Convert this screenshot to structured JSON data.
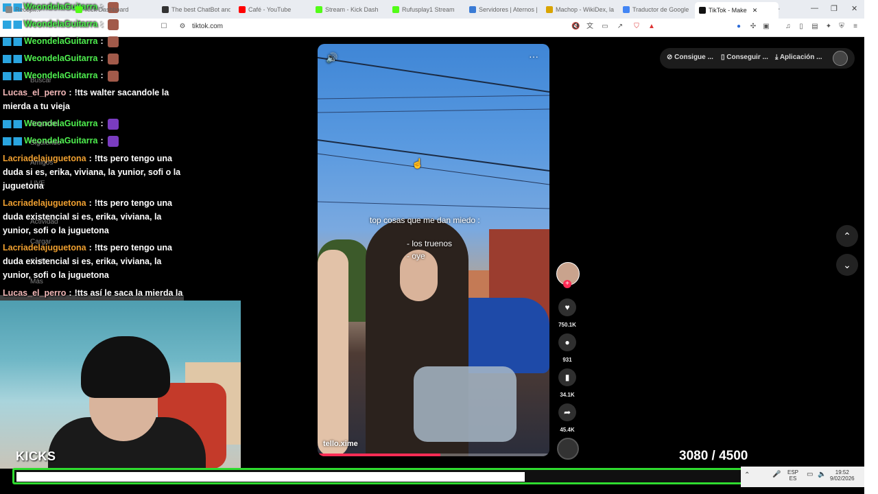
{
  "browser": {
    "tabs": [
      {
        "label": "Recopi…",
        "color": "#888888"
      },
      {
        "label": "Kick Dashboard",
        "color": "#53fc18"
      },
      {
        "label": "The best ChatBot and",
        "color": "#333333"
      },
      {
        "label": "Café - YouTube",
        "color": "#ff0000"
      },
      {
        "label": "Stream - Kick Dash",
        "color": "#53fc18"
      },
      {
        "label": "Rufusplay1 Stream",
        "color": "#53fc18"
      },
      {
        "label": "Servidores | Aternos | E",
        "color": "#3a7bd5"
      },
      {
        "label": "Machop - WikiDex, la",
        "color": "#d9a400"
      },
      {
        "label": "Traductor de Google",
        "color": "#4285f4"
      },
      {
        "label": "TikTok - Make",
        "color": "#111111"
      }
    ],
    "url": "tiktok.com",
    "new_tab": "+",
    "window": {
      "minimize": "—",
      "restore": "❐",
      "close": "✕"
    }
  },
  "tiktok": {
    "top_pill": {
      "item1": "Consigue ...",
      "item2": "Conseguir ...",
      "item3": "Aplicación ..."
    },
    "sidebar_ghost": [
      "Buscar",
      "Seguidos",
      "Siguiendo",
      "Amigos",
      "LIVE",
      "Actividad",
      "Cargar",
      "Perfil",
      "Más"
    ],
    "video": {
      "caption_title": "top cosas que me dan miedo :",
      "caption_line1": "- los truenos",
      "caption_line2": "- oye",
      "author": "tello.xime",
      "more": "···",
      "progress": 0.53
    },
    "actions": {
      "likes": "750.1K",
      "comments": "931",
      "saves": "34.1K",
      "shares": "45.4K"
    }
  },
  "chat": [
    {
      "user": "WeondelaGuitarra",
      "sep": ":",
      "msg": "",
      "emote": "#a25a4a",
      "color": "green",
      "badges": true
    },
    {
      "user": "WeondelaGuitarra",
      "sep": ":",
      "msg": "",
      "emote": "#a25a4a",
      "color": "green",
      "badges": true
    },
    {
      "user": "WeondelaGuitarra",
      "sep": ":",
      "msg": "",
      "emote": "#a25a4a",
      "color": "green",
      "badges": true
    },
    {
      "user": "WeondelaGuitarra",
      "sep": ":",
      "msg": "",
      "emote": "#a25a4a",
      "color": "green",
      "badges": true
    },
    {
      "user": "WeondelaGuitarra",
      "sep": ":",
      "msg": "",
      "emote": "#a25a4a",
      "color": "green",
      "badges": true
    },
    {
      "user": "Lucas_el_perro",
      "sep": ":",
      "msg": "!tts walter sacandole la mierda a tu vieja",
      "color": "pink",
      "badges": false
    },
    {
      "user": "WeondelaGuitarra",
      "sep": ":",
      "msg": "",
      "emote": "#7a3cc0",
      "color": "green",
      "badges": true
    },
    {
      "user": "WeondelaGuitarra",
      "sep": ":",
      "msg": "",
      "emote": "#7a3cc0",
      "color": "green",
      "badges": true
    },
    {
      "user": "Lacriadelajuguetona",
      "sep": ":",
      "msg": "!tts pero tengo una duda si es, erika, viviana, la yunior, sofi o la juguetona",
      "color": "orange",
      "badges": false
    },
    {
      "user": "Lacriadelajuguetona",
      "sep": ":",
      "msg": "!tts pero tengo una duda existencial si es, erika, viviana, la yunior, sofi o la juguetona",
      "color": "orange",
      "badges": false
    },
    {
      "user": "Lacriadelajuguetona",
      "sep": ":",
      "msg": "!tts pero tengo una duda existencial si es, erika, viviana, la yunior, sofi o la juguetona",
      "color": "orange",
      "badges": false
    },
    {
      "user": "Lucas_el_perro",
      "sep": ":",
      "msg": "!tts así le saca la mierda la payasa al enano",
      "color": "pink",
      "badges": false
    }
  ],
  "overlay": {
    "kicks_label": "KICKS",
    "counter": "3080  / 4500",
    "goal_progress": 0.68
  },
  "taskbar": {
    "lang": "ESP",
    "lang2": "ES",
    "time": "19:52",
    "date": "9/02/2026"
  }
}
